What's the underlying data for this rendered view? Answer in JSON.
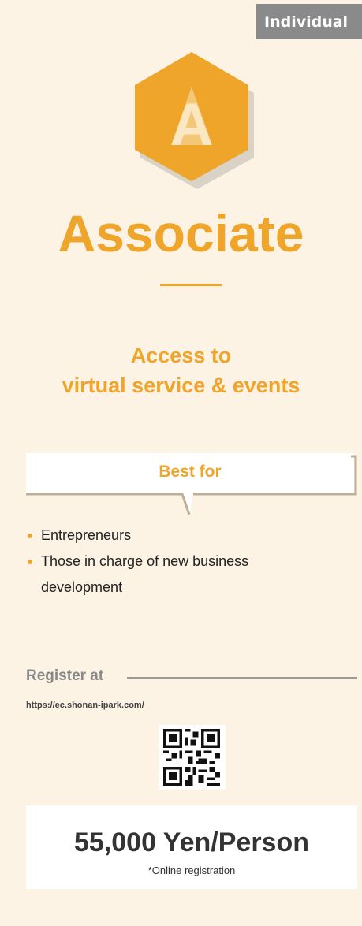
{
  "tag": "Individual",
  "badge_letter": "A",
  "title": "Associate",
  "access": {
    "line1": "Access to",
    "line2": "virtual service & events"
  },
  "best_for": {
    "label": "Best for",
    "items": [
      "Entrepreneurs",
      "Those in charge of new business",
      "development"
    ]
  },
  "register": {
    "label": "Register at",
    "url": "https://ec.shonan-ipark.com/"
  },
  "price": {
    "amount": "55,000 Yen/Person",
    "note": "*Online registration"
  },
  "icons": {
    "badge": "hexagon-letter-icon",
    "bullet": "bullet-dot-icon",
    "qr": "qr-code-icon"
  },
  "colors": {
    "accent": "#eea52a",
    "highlight": "#fbe84a",
    "background": "#fdf3e5",
    "tag": "#8a8a8a"
  }
}
